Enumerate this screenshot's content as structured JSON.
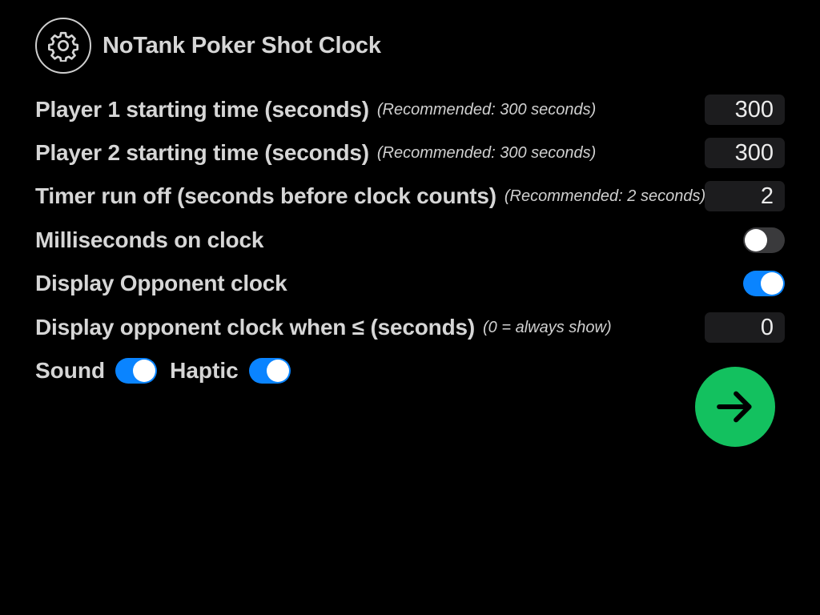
{
  "header": {
    "title": "NoTank Poker Shot Clock",
    "settings_icon": "gear-icon"
  },
  "settings": {
    "player1": {
      "label": "Player 1 starting time (seconds)",
      "hint": "(Recommended: 300 seconds)",
      "value": "300"
    },
    "player2": {
      "label": "Player 2 starting time (seconds)",
      "hint": "(Recommended: 300 seconds)",
      "value": "300"
    },
    "runoff": {
      "label": "Timer run off (seconds before clock counts)",
      "hint": "(Recommended: 2 seconds)",
      "value": "2"
    },
    "milliseconds": {
      "label": "Milliseconds on clock",
      "enabled": false
    },
    "opponent_clock": {
      "label": "Display Opponent clock",
      "enabled": true
    },
    "opponent_threshold": {
      "label": "Display opponent clock when ≤ (seconds)",
      "hint": "(0 = always show)",
      "value": "0"
    },
    "sound": {
      "label": "Sound",
      "enabled": true
    },
    "haptic": {
      "label": "Haptic",
      "enabled": true
    }
  },
  "actions": {
    "continue_icon": "arrow-right-icon"
  },
  "colors": {
    "background": "#000000",
    "text": "#d6d6d6",
    "field_background": "#1c1c1e",
    "toggle_on": "#0a84ff",
    "toggle_off": "#3a3a3c",
    "go_button": "#13c15f"
  }
}
